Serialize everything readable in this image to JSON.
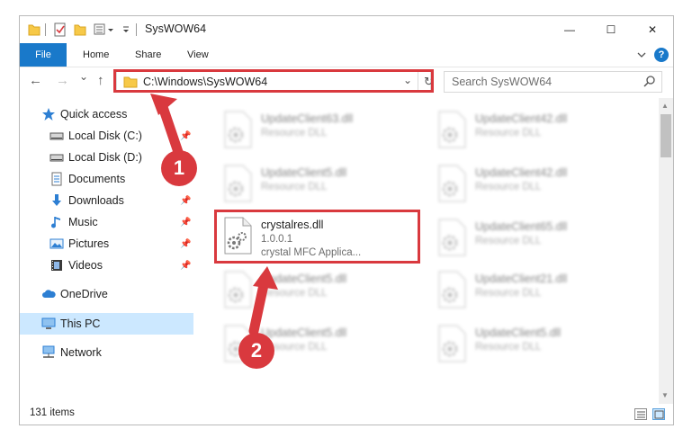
{
  "window": {
    "title": "SysWOW64",
    "minimize_glyph": "—",
    "maximize_glyph": "☐",
    "close_glyph": "✕"
  },
  "ribbon": {
    "tabs": [
      "File",
      "Home",
      "Share",
      "View"
    ],
    "help_glyph": "?"
  },
  "nav": {
    "back_glyph": "←",
    "forward_glyph": "→",
    "recent_glyph": "⌄",
    "up_glyph": "↑",
    "address": "C:\\Windows\\SysWOW64",
    "address_chevron": "⌄",
    "refresh_glyph": "↻",
    "search_placeholder": "Search SysWOW64"
  },
  "sidebar": {
    "items": [
      {
        "label": "Quick access",
        "icon": "star-icon",
        "pinned": false
      },
      {
        "label": "Local Disk (C:)",
        "icon": "drive-icon",
        "pinned": true
      },
      {
        "label": "Local Disk (D:)",
        "icon": "drive-icon",
        "pinned": true
      },
      {
        "label": "Documents",
        "icon": "documents-icon",
        "pinned": true
      },
      {
        "label": "Downloads",
        "icon": "downloads-icon",
        "pinned": true
      },
      {
        "label": "Music",
        "icon": "music-icon",
        "pinned": true
      },
      {
        "label": "Pictures",
        "icon": "pictures-icon",
        "pinned": true
      },
      {
        "label": "Videos",
        "icon": "videos-icon",
        "pinned": true
      },
      {
        "label": "OneDrive",
        "icon": "cloud-icon",
        "pinned": false
      },
      {
        "label": "This PC",
        "icon": "computer-icon",
        "pinned": false,
        "selected": true
      },
      {
        "label": "Network",
        "icon": "network-icon",
        "pinned": false
      }
    ],
    "pin_glyph": "📌"
  },
  "files": [
    {
      "name": "UpdateClient63.dll",
      "line1": "Resource DLL",
      "line2": "",
      "blurred": true
    },
    {
      "name": "UpdateClient42.dll",
      "line1": "Resource DLL",
      "line2": "",
      "blurred": true
    },
    {
      "name": "UpdateClient5.dll",
      "line1": "Resource DLL",
      "line2": "",
      "blurred": true
    },
    {
      "name": "UpdateClient42.dll",
      "line1": "Resource DLL",
      "line2": "",
      "blurred": true
    },
    {
      "name": "crystalres.dll",
      "line1": "1.0.0.1",
      "line2": "crystal MFC Applica...",
      "blurred": false
    },
    {
      "name": "UpdateClient65.dll",
      "line1": "Resource DLL",
      "line2": "",
      "blurred": true
    },
    {
      "name": "UpdateClient5.dll",
      "line1": "Resource DLL",
      "line2": "",
      "blurred": true
    },
    {
      "name": "UpdateClient21.dll",
      "line1": "Resource DLL",
      "line2": "",
      "blurred": true
    },
    {
      "name": "UpdateClient5.dll",
      "line1": "Resource DLL",
      "line2": "",
      "blurred": true
    },
    {
      "name": "UpdateClient5.dll",
      "line1": "Resource DLL",
      "line2": "",
      "blurred": true
    }
  ],
  "status": {
    "item_count": "131 items"
  },
  "callouts": [
    "1",
    "2"
  ],
  "colors": {
    "accent": "#1979ca",
    "annotation": "#d9393e",
    "selected": "#cce8ff",
    "folder": "#f7c948"
  }
}
